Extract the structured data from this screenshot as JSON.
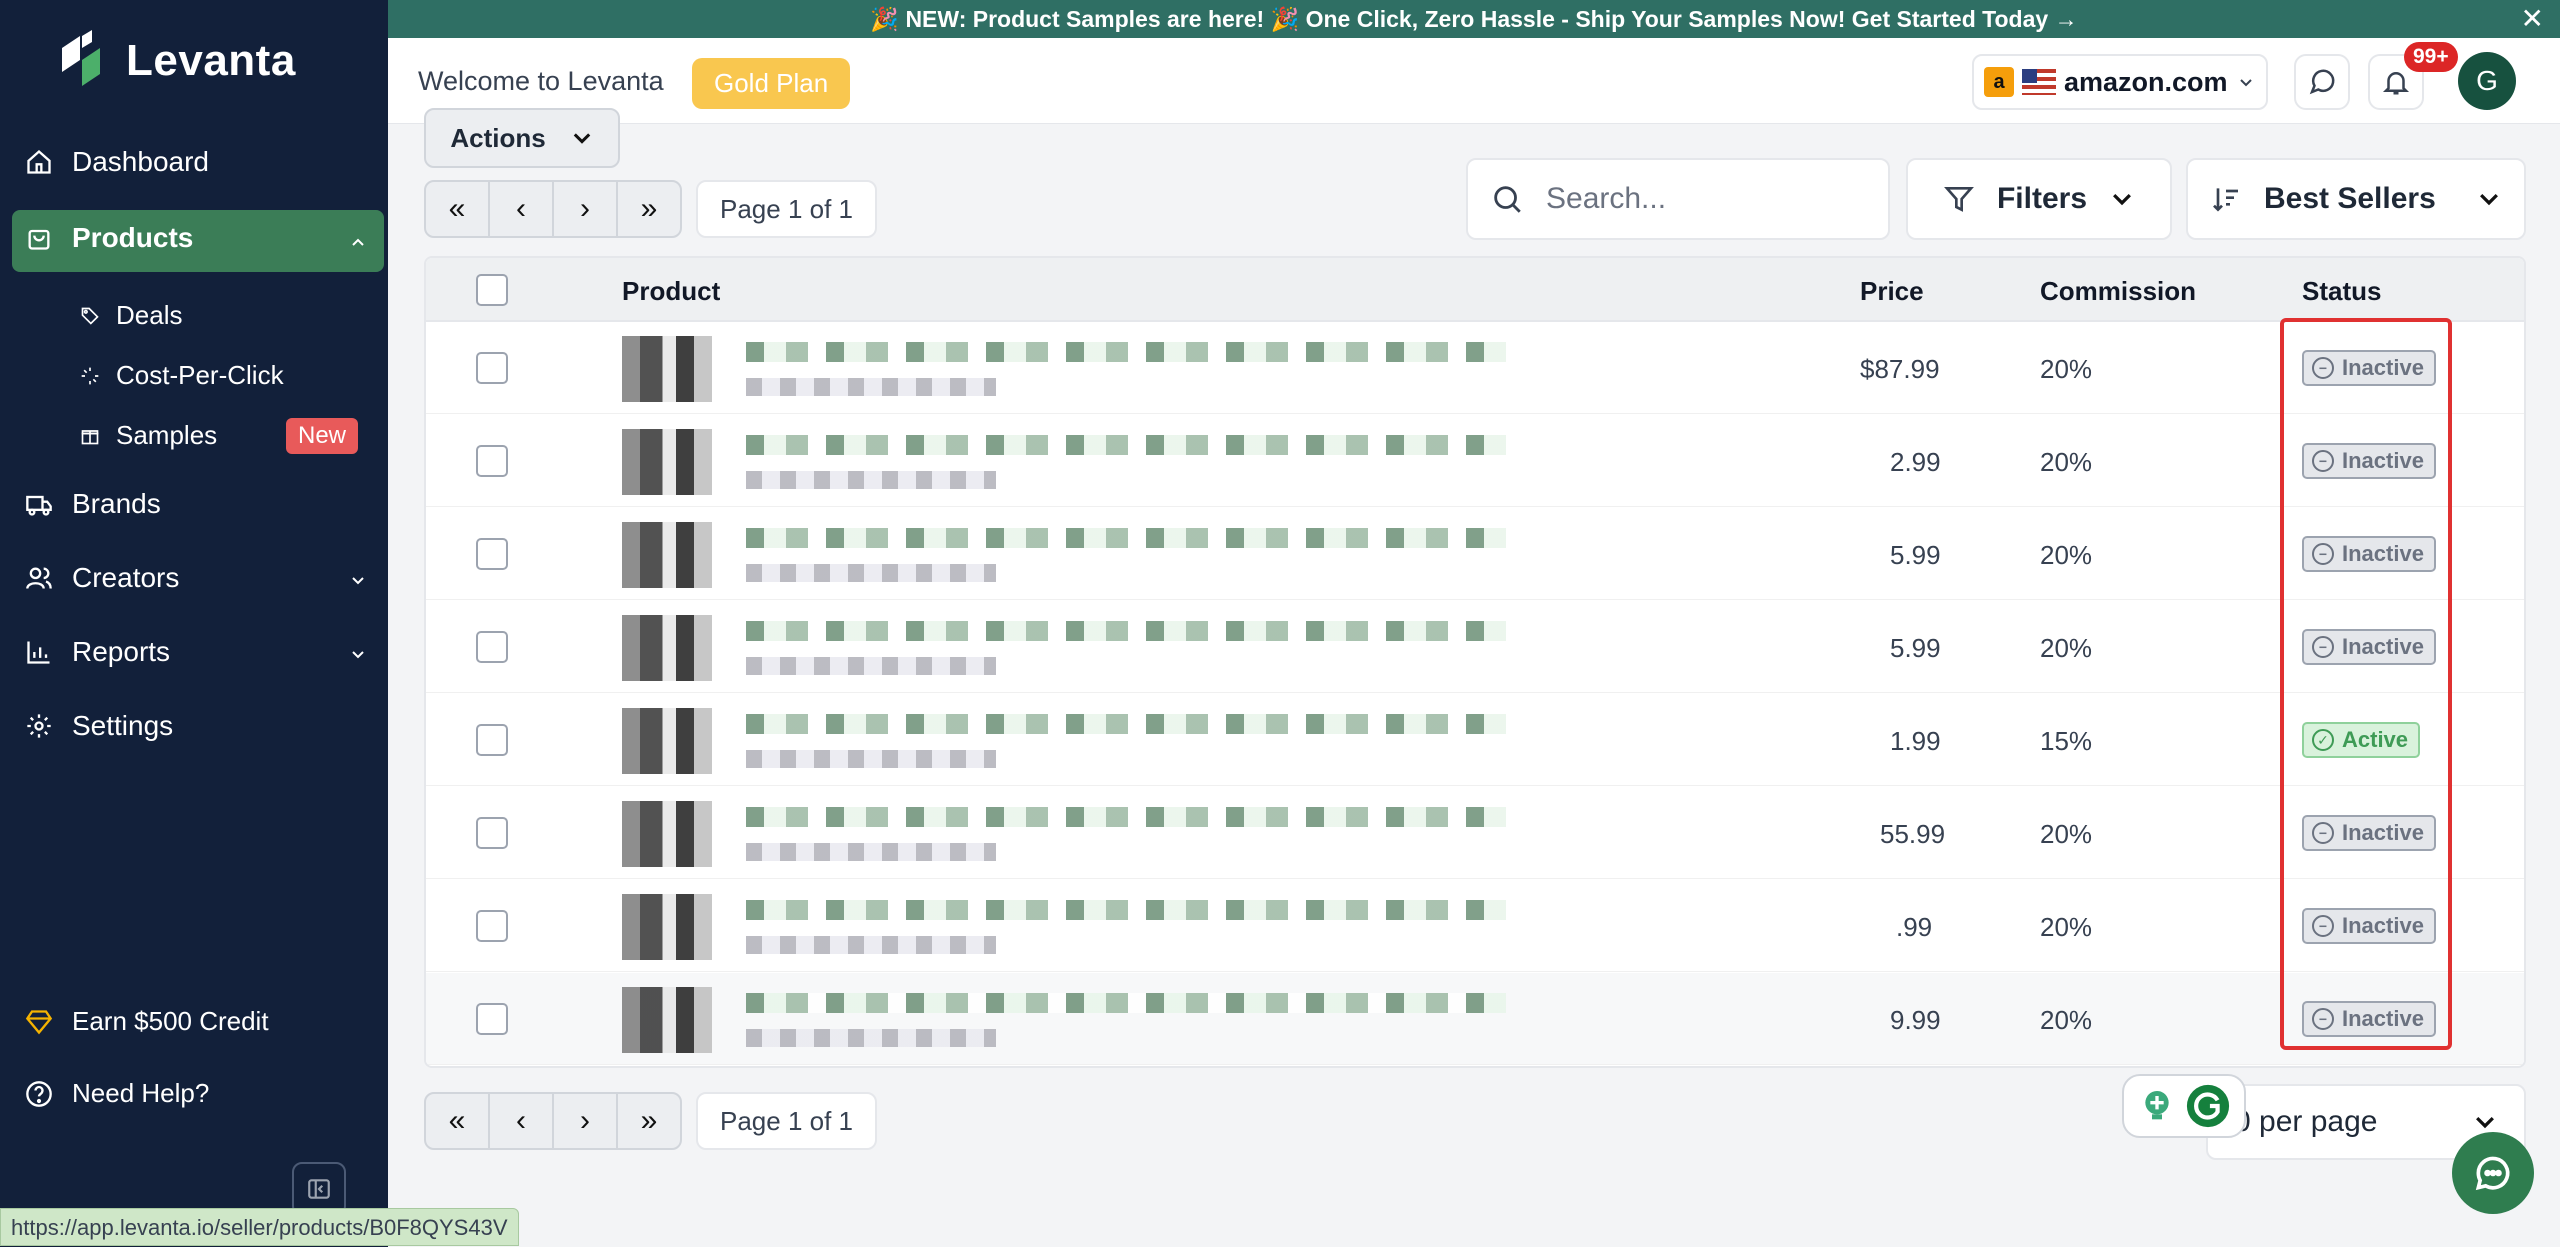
{
  "banner": {
    "text": "🎉 NEW: Product Samples are here! 🎉 One Click, Zero Hassle - Ship Your Samples Now!   Get Started Today →",
    "close": "✕"
  },
  "brand": {
    "name": "Levanta"
  },
  "sidebar": {
    "items": [
      {
        "label": "Dashboard",
        "icon": "home-icon"
      },
      {
        "label": "Products",
        "icon": "bag-icon"
      },
      {
        "label": "Brands",
        "icon": "truck-icon"
      },
      {
        "label": "Creators",
        "icon": "users-icon"
      },
      {
        "label": "Reports",
        "icon": "chart-icon"
      },
      {
        "label": "Settings",
        "icon": "gear-icon"
      }
    ],
    "sub_items": [
      {
        "label": "Deals",
        "icon": "tag-icon"
      },
      {
        "label": "Cost-Per-Click",
        "icon": "cursor-icon"
      },
      {
        "label": "Samples",
        "icon": "gift-icon"
      }
    ],
    "new_badge": "New",
    "earn_credit": "Earn $500 Credit",
    "need_help": "Need Help?"
  },
  "header": {
    "welcome": "Welcome to Levanta",
    "plan": "Gold Plan",
    "marketplace": "amazon.com",
    "notifications": "99+",
    "avatar": "G"
  },
  "toolbar": {
    "actions": "Actions",
    "page_indicator": "Page 1 of 1",
    "search_placeholder": "Search...",
    "filters": "Filters",
    "sort": "Best Sellers"
  },
  "table": {
    "columns": [
      "Product",
      "Price",
      "Commission",
      "Status"
    ],
    "rows": [
      {
        "price": "$87.99",
        "commission": "20%",
        "status": "Inactive"
      },
      {
        "price": "2.99",
        "commission": "20%",
        "status": "Inactive"
      },
      {
        "price": "5.99",
        "commission": "20%",
        "status": "Inactive"
      },
      {
        "price": "5.99",
        "commission": "20%",
        "status": "Inactive"
      },
      {
        "price": "1.99",
        "commission": "15%",
        "status": "Active"
      },
      {
        "price": "55.99",
        "commission": "20%",
        "status": "Inactive"
      },
      {
        "price": ".99",
        "commission": "20%",
        "status": "Inactive"
      },
      {
        "price": "9.99",
        "commission": "20%",
        "status": "Inactive"
      }
    ]
  },
  "footer": {
    "per_page": "0 per page",
    "page_indicator": "Page 1 of 1"
  },
  "status_bar_url": "https://app.levanta.io/seller/products/B0F8QYS43V",
  "colors": {
    "sidebar_bg": "#12203a",
    "accent_green": "#3b7d57",
    "banner_bg": "#2f6f64",
    "plan_gold": "#f9c74f",
    "highlight_red": "#e03131"
  }
}
